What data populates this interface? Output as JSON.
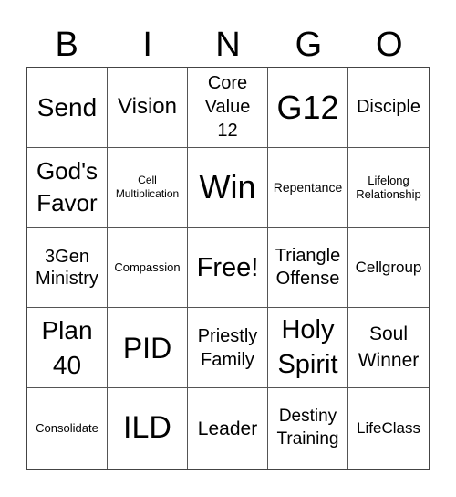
{
  "header": [
    "B",
    "I",
    "N",
    "G",
    "O"
  ],
  "cells": [
    "Send",
    "Vision",
    "Core\nValue\n12",
    "G12",
    "Disciple",
    "God's\nFavor",
    "Cell\nMultiplication",
    "Win",
    "Repentance",
    "Lifelong\nRelationship",
    "3Gen\nMinistry",
    "Compassion",
    "Free!",
    "Triangle\nOffense",
    "Cellgroup",
    "Plan\n40",
    "PID",
    "Priestly\nFamily",
    "Holy\nSpirit",
    "Soul\nWinner",
    "Consolidate",
    "ILD",
    "Leader",
    "Destiny\nTraining",
    "LifeClass"
  ]
}
